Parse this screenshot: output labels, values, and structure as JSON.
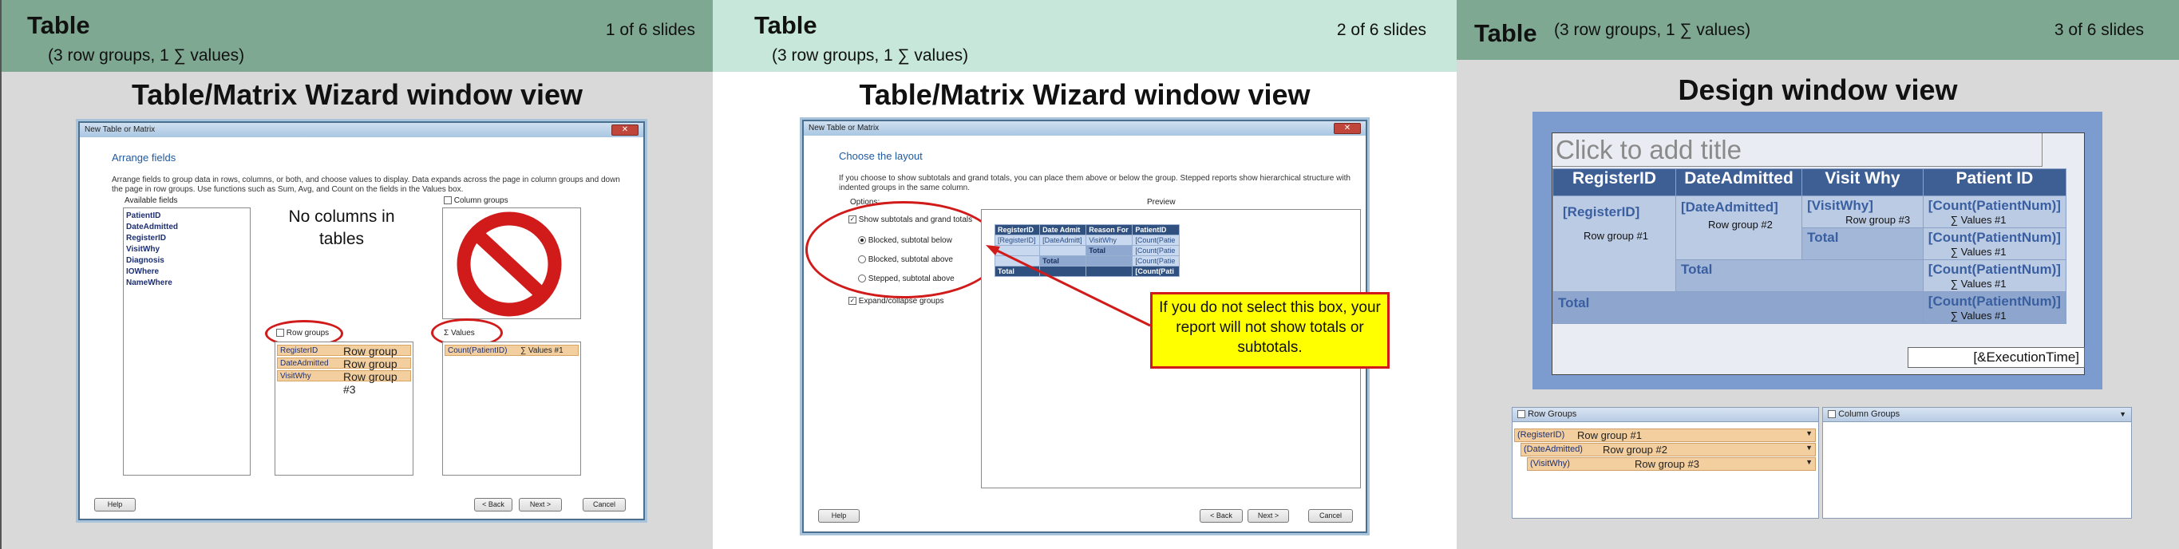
{
  "slides": [
    {
      "title": "Table",
      "subtitle": "(3 row groups, 1 ∑ values)",
      "counter": "1 of 6 slides",
      "view_title": "Table/Matrix Wizard window view",
      "window": {
        "title": "New Table or Matrix",
        "heading": "Arrange fields",
        "description": "Arrange fields to group data in rows, columns, or both, and choose values to display. Data expands across the page in column groups and down the page in row groups.  Use functions such as Sum, Avg, and Count on the fields in the Values box.",
        "available_label": "Available fields",
        "available_fields": [
          "PatientID",
          "DateAdmitted",
          "RegisterID",
          "VisitWhy",
          "Diagnosis",
          "IOWhere",
          "NameWhere"
        ],
        "column_groups_label": "Column groups",
        "no_columns_text": "No columns in tables",
        "row_groups_label": "Row groups",
        "row_groups": [
          {
            "field": "RegisterID",
            "note": "Row group #1"
          },
          {
            "field": "DateAdmitted",
            "note": "Row group #2"
          },
          {
            "field": "VisitWhy",
            "note": "Row group #3"
          }
        ],
        "values_label": "Values",
        "values_icon": "Σ",
        "value_field": "Count(PatientID)",
        "value_note": "∑ Values #1",
        "buttons": {
          "help": "Help",
          "back": "< Back",
          "next": "Next >",
          "cancel": "Cancel"
        }
      }
    },
    {
      "title": "Table",
      "subtitle": "(3 row groups, 1 ∑ values)",
      "counter": "2 of 6 slides",
      "view_title": "Table/Matrix Wizard window view",
      "window": {
        "title": "New Table or Matrix",
        "heading": "Choose the layout",
        "description": "If you choose to show subtotals and grand totals, you can place them above or below the group. Stepped reports show hierarchical structure with indented groups in the same column.",
        "options_label": "Options:",
        "preview_label": "Preview",
        "options": [
          {
            "label": "Show subtotals and grand totals",
            "kind": "checkbox",
            "checked": true
          },
          {
            "label": "Blocked, subtotal below",
            "kind": "radio",
            "checked": true
          },
          {
            "label": "Blocked, subtotal above",
            "kind": "radio",
            "checked": false
          },
          {
            "label": "Stepped, subtotal above",
            "kind": "radio",
            "checked": false
          },
          {
            "label": "Expand/collapse groups",
            "kind": "checkbox",
            "checked": true
          }
        ],
        "preview": {
          "headers": [
            "RegisterID",
            "Date Admit",
            "Reason For",
            "PatientID"
          ],
          "cells": {
            "r1c1": "[RegisterID]",
            "r1c2": "[DateAdmitt]",
            "r1c3": "VisitWhy",
            "r1c4": "[Count(Patie",
            "r2c3": "Total",
            "r2c4": "[Count(Patie",
            "r3c2": "Total",
            "r3c4": "[Count(Patie",
            "r4c1": "Total",
            "r4c4": "[Count(Pati"
          }
        },
        "callout": "If you do not select this box, your report will not show totals or subtotals.",
        "buttons": {
          "help": "Help",
          "back": "< Back",
          "next": "Next >",
          "cancel": "Cancel"
        }
      }
    },
    {
      "title": "Table",
      "subtitle": "(3 row groups, 1 ∑ values)",
      "counter": "3 of 6 slides",
      "view_title": "Design window view",
      "design": {
        "title_placeholder": "Click to add title",
        "headers": [
          "RegisterID",
          "DateAdmitted",
          "Visit Why",
          "Patient ID"
        ],
        "register": "[RegisterID]",
        "register_note": "Row group #1",
        "date": "[DateAdmitted]",
        "date_note": "Row group #2",
        "visit": "[VisitWhy]",
        "visit_note": "Row group #3",
        "count": "[Count(PatientNum)]",
        "values_note": "∑ Values #1",
        "total": "Total",
        "execution": "[&ExecutionTime]"
      },
      "groups_pane": {
        "row_groups_label": "Row Groups",
        "column_groups_label": "Column Groups",
        "rows": [
          {
            "field": "(RegisterID)",
            "note": "Row group #1"
          },
          {
            "field": "(DateAdmitted)",
            "note": "Row group #2"
          },
          {
            "field": "(VisitWhy)",
            "note": "Row group #3"
          }
        ]
      }
    }
  ],
  "colors": {
    "header_dark": "#7fa892",
    "header_light": "#c6e7d9",
    "highlight_ring": "#d11b1b",
    "callout_fill": "#ffff00",
    "group_row": "#f3cf9f",
    "design_header": "#3e5f94"
  }
}
